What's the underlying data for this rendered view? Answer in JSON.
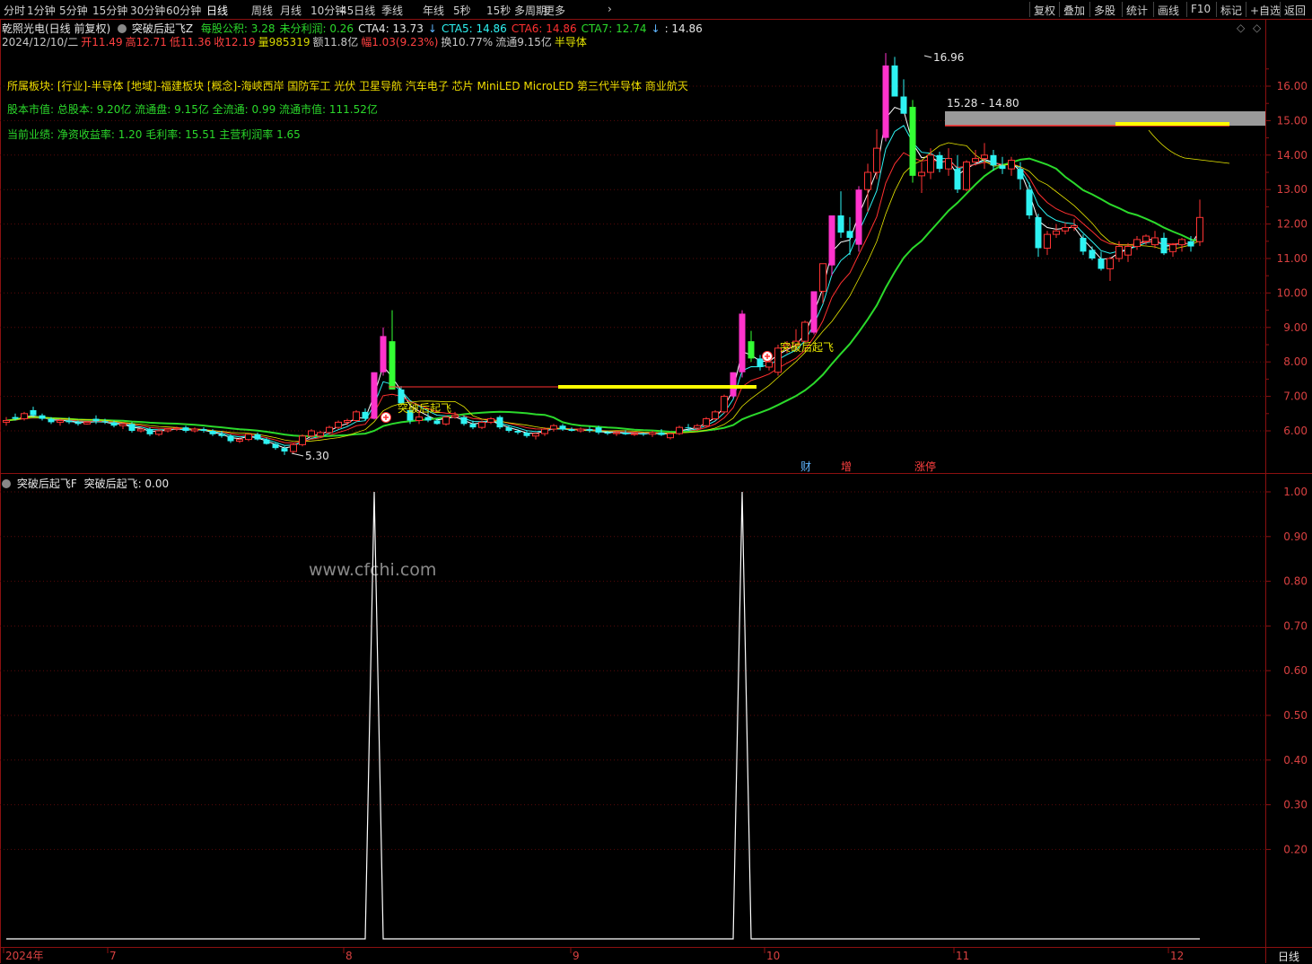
{
  "toolbar": {
    "periods": [
      "分时",
      "1分钟",
      "5分钟",
      "15分钟",
      "30分钟",
      "60分钟",
      "日线",
      "周线",
      "月线",
      "10分钟",
      "45日线",
      "季线",
      "年线",
      "5秒",
      "15秒",
      "多周期",
      "更多"
    ],
    "active": "日线",
    "right_buttons": [
      "复权",
      "叠加",
      "多股",
      "统计",
      "画线",
      "F10",
      "标记",
      "+自选",
      "返回"
    ]
  },
  "header": {
    "stock": "乾照光电(日线 前复权)",
    "indicator": "突破后起飞Z",
    "stats": [
      {
        "text": "每股公积: 3.28",
        "color": "#2bd92b"
      },
      {
        "text": "未分利润: 0.26",
        "color": "#2bd92b"
      },
      {
        "text": "CTA4: 13.73",
        "color": "#e6e6e6"
      },
      {
        "text": "↓",
        "color": "#5fb5ff"
      },
      {
        "text": "CTA5: 14.86",
        "color": "#2ef2f2"
      },
      {
        "text": "CTA6: 14.86",
        "color": "#ff3030"
      },
      {
        "text": "CTA7: 12.74",
        "color": "#2bd92b"
      },
      {
        "text": "↓",
        "color": "#5fb5ff"
      },
      {
        "text": ": 14.86",
        "color": "#e6e6e6"
      }
    ],
    "quote": [
      {
        "text": "2024/12/10/二",
        "color": "#c8c8c8"
      },
      {
        "text": "开11.49",
        "color": "#ff4040"
      },
      {
        "text": "高12.71",
        "color": "#ff4040"
      },
      {
        "text": "低11.36",
        "color": "#ff4040"
      },
      {
        "text": "收12.19",
        "color": "#ff4040"
      },
      {
        "text": "量985319",
        "color": "#d8d800"
      },
      {
        "text": "额11.8亿",
        "color": "#c8c8c8"
      },
      {
        "text": "幅1.03(9.23%)",
        "color": "#ff4040"
      },
      {
        "text": "换10.77%",
        "color": "#c8c8c8"
      },
      {
        "text": "流通9.15亿",
        "color": "#c8c8c8"
      },
      {
        "text": "半导体",
        "color": "#e6e600"
      }
    ]
  },
  "info_panel": {
    "sectors": "所属板块: [行业]-半导体 [地域]-福建板块 [概念]-海峡西岸 国防军工 光伏 卫星导航 汽车电子 芯片 MiniLED MicroLED 第三代半导体 商业航天",
    "capital": "股本市值: 总股本: 9.20亿 流通盘: 9.15亿 全流通: 0.99 流通市值: 111.52亿",
    "performance": "当前业绩: 净资收益率: 1.20 毛利率: 15.51 主营利润率 1.65"
  },
  "price_axis": [
    "16.00",
    "15.00",
    "14.00",
    "13.00",
    "12.00",
    "11.00",
    "10.00",
    "9.00",
    "8.00",
    "7.00",
    "6.00"
  ],
  "annotations": {
    "high": "16.96",
    "low": "5.30",
    "range": "15.28 - 14.80",
    "signal": "突破后起飞",
    "markers": [
      "财",
      "增",
      "涨停"
    ]
  },
  "sub_header": {
    "indicator": "突破后起飞F",
    "value": "突破后起飞: 0.00"
  },
  "sub_axis": [
    "1.00",
    "0.90",
    "0.80",
    "0.70",
    "0.60",
    "0.50",
    "0.40",
    "0.30",
    "0.20"
  ],
  "watermark": "www.cfchi.com",
  "date_axis": [
    "2024年",
    "7",
    "8",
    "9",
    "10",
    "11",
    "12"
  ],
  "period_label": "日线",
  "colors": {
    "up": "#ff3333",
    "down": "#2ef2f2",
    "limit_up": "#ff33cc",
    "limit_down": "#33ff33",
    "border": "#8b1010"
  },
  "chart_data": {
    "type": "candlestick",
    "price_range": [
      5.0,
      17.0
    ],
    "candles": [
      [
        6.25,
        6.4,
        6.15,
        6.3
      ],
      [
        6.4,
        6.5,
        6.3,
        6.35
      ],
      [
        6.35,
        6.55,
        6.3,
        6.5
      ],
      [
        6.6,
        6.7,
        6.4,
        6.45
      ],
      [
        6.45,
        6.5,
        6.3,
        6.35
      ],
      [
        6.35,
        6.4,
        6.2,
        6.25
      ],
      [
        6.25,
        6.35,
        6.15,
        6.3
      ],
      [
        6.3,
        6.4,
        6.2,
        6.25
      ],
      [
        6.25,
        6.3,
        6.15,
        6.2
      ],
      [
        6.2,
        6.28,
        6.18,
        6.25
      ],
      [
        6.35,
        6.45,
        6.2,
        6.28
      ],
      [
        6.28,
        6.35,
        6.2,
        6.25
      ],
      [
        6.25,
        6.3,
        6.1,
        6.15
      ],
      [
        6.15,
        6.25,
        6.05,
        6.2
      ],
      [
        6.2,
        6.25,
        5.95,
        6.0
      ],
      [
        6.0,
        6.1,
        5.95,
        6.05
      ],
      [
        6.05,
        6.1,
        5.85,
        5.9
      ],
      [
        5.9,
        6.05,
        5.85,
        6.0
      ],
      [
        6.0,
        6.05,
        5.95,
        6.05
      ],
      [
        6.05,
        6.12,
        6.0,
        6.08
      ],
      [
        6.1,
        6.15,
        5.95,
        6.0
      ],
      [
        6.0,
        6.1,
        5.95,
        6.05
      ],
      [
        6.05,
        6.1,
        5.95,
        6.0
      ],
      [
        6.0,
        6.05,
        5.85,
        5.9
      ],
      [
        5.9,
        6.0,
        5.8,
        5.85
      ],
      [
        5.85,
        5.9,
        5.65,
        5.7
      ],
      [
        5.7,
        5.8,
        5.65,
        5.75
      ],
      [
        5.75,
        5.92,
        5.7,
        5.9
      ],
      [
        5.9,
        5.95,
        5.72,
        5.75
      ],
      [
        5.75,
        5.8,
        5.6,
        5.62
      ],
      [
        5.62,
        5.65,
        5.45,
        5.5
      ],
      [
        5.5,
        5.55,
        5.3,
        5.4
      ],
      [
        5.4,
        5.65,
        5.35,
        5.6
      ],
      [
        5.6,
        5.9,
        5.55,
        5.85
      ],
      [
        5.85,
        6.05,
        5.8,
        6.0
      ],
      [
        5.85,
        6.0,
        5.8,
        5.95
      ],
      [
        5.95,
        6.15,
        5.9,
        6.1
      ],
      [
        6.1,
        6.3,
        6.05,
        6.25
      ],
      [
        6.25,
        6.35,
        6.15,
        6.3
      ],
      [
        6.3,
        6.6,
        6.25,
        6.55
      ],
      [
        6.55,
        6.65,
        6.3,
        6.35
      ],
      [
        6.35,
        7.7,
        6.33,
        7.7
      ],
      [
        7.7,
        9.0,
        7.6,
        8.75
      ],
      [
        8.6,
        9.5,
        7.2,
        7.2
      ],
      [
        7.2,
        7.3,
        6.8,
        6.8
      ],
      [
        6.6,
        6.7,
        6.2,
        6.3
      ],
      [
        6.3,
        6.6,
        6.2,
        6.4
      ],
      [
        6.4,
        6.55,
        6.25,
        6.3
      ],
      [
        6.3,
        6.35,
        6.18,
        6.2
      ],
      [
        6.2,
        6.45,
        6.15,
        6.4
      ],
      [
        6.4,
        6.55,
        6.35,
        6.45
      ],
      [
        6.4,
        6.45,
        6.15,
        6.2
      ],
      [
        6.2,
        6.3,
        6.05,
        6.1
      ],
      [
        6.1,
        6.3,
        6.05,
        6.25
      ],
      [
        6.25,
        6.4,
        6.2,
        6.35
      ],
      [
        6.4,
        6.45,
        6.05,
        6.1
      ],
      [
        6.1,
        6.15,
        5.95,
        6.0
      ],
      [
        6.0,
        6.05,
        5.9,
        5.95
      ],
      [
        5.95,
        6.0,
        5.8,
        5.85
      ],
      [
        5.85,
        5.95,
        5.75,
        5.92
      ],
      [
        5.92,
        6.1,
        5.85,
        6.05
      ],
      [
        6.05,
        6.2,
        5.98,
        6.15
      ],
      [
        6.15,
        6.2,
        6.0,
        6.05
      ],
      [
        6.05,
        6.1,
        5.98,
        6.0
      ],
      [
        6.0,
        6.1,
        5.95,
        6.05
      ],
      [
        6.05,
        6.12,
        5.95,
        6.0
      ],
      [
        6.1,
        6.15,
        5.9,
        5.95
      ],
      [
        5.95,
        6.0,
        5.88,
        5.92
      ],
      [
        5.92,
        6.0,
        5.85,
        5.95
      ],
      [
        5.95,
        6.02,
        5.88,
        5.9
      ],
      [
        5.9,
        5.95,
        5.85,
        5.92
      ],
      [
        5.92,
        5.95,
        5.85,
        5.9
      ],
      [
        5.9,
        6.0,
        5.82,
        5.95
      ],
      [
        5.95,
        6.05,
        5.85,
        5.88
      ],
      [
        5.8,
        5.95,
        5.75,
        5.92
      ],
      [
        5.92,
        6.15,
        5.88,
        6.1
      ],
      [
        6.1,
        6.2,
        6.0,
        6.08
      ],
      [
        6.08,
        6.2,
        6.0,
        6.15
      ],
      [
        6.15,
        6.4,
        6.1,
        6.35
      ],
      [
        6.35,
        6.6,
        6.3,
        6.55
      ],
      [
        6.55,
        7.05,
        6.5,
        7.0
      ],
      [
        7.0,
        7.7,
        6.95,
        7.7
      ],
      [
        7.7,
        9.5,
        7.55,
        9.4
      ],
      [
        8.6,
        8.9,
        8.0,
        8.1
      ],
      [
        8.1,
        8.2,
        7.75,
        7.85
      ],
      [
        7.85,
        8.05,
        7.75,
        8.0
      ],
      [
        7.7,
        8.5,
        7.6,
        8.4
      ],
      [
        8.4,
        8.6,
        8.25,
        8.5
      ],
      [
        8.5,
        8.95,
        8.35,
        8.6
      ],
      [
        8.6,
        9.2,
        8.55,
        9.15
      ],
      [
        8.85,
        10.05,
        8.8,
        10.05
      ],
      [
        10.05,
        10.8,
        9.7,
        10.85
      ],
      [
        10.8,
        12.25,
        10.5,
        12.25
      ],
      [
        12.25,
        12.95,
        11.6,
        11.75
      ],
      [
        11.8,
        12.2,
        11.1,
        11.6
      ],
      [
        11.4,
        13.1,
        11.2,
        13.0
      ],
      [
        13.0,
        13.75,
        12.35,
        13.5
      ],
      [
        13.5,
        14.75,
        13.3,
        14.2
      ],
      [
        14.5,
        16.96,
        14.4,
        16.6
      ],
      [
        16.6,
        16.85,
        15.8,
        15.7
      ],
      [
        15.7,
        16.2,
        15.3,
        15.2
      ],
      [
        15.4,
        15.6,
        13.2,
        13.4
      ],
      [
        13.4,
        13.8,
        12.9,
        13.5
      ],
      [
        13.5,
        14.2,
        13.3,
        14.0
      ],
      [
        14.0,
        14.1,
        13.5,
        13.6
      ],
      [
        13.6,
        14.2,
        13.4,
        13.9
      ],
      [
        13.6,
        14.0,
        12.9,
        13.0
      ],
      [
        13.0,
        13.85,
        12.95,
        13.8
      ],
      [
        13.8,
        14.15,
        13.7,
        13.9
      ],
      [
        13.9,
        14.35,
        13.6,
        14.0
      ],
      [
        14.0,
        14.15,
        13.55,
        13.7
      ],
      [
        13.7,
        13.95,
        13.45,
        13.6
      ],
      [
        13.6,
        13.95,
        13.4,
        13.85
      ],
      [
        13.6,
        13.8,
        13.0,
        13.3
      ],
      [
        13.0,
        13.2,
        12.15,
        12.25
      ],
      [
        12.2,
        12.3,
        11.05,
        11.3
      ],
      [
        11.3,
        11.8,
        11.1,
        11.7
      ],
      [
        11.7,
        12.0,
        11.6,
        11.8
      ],
      [
        11.8,
        12.05,
        11.7,
        11.9
      ],
      [
        11.9,
        12.15,
        11.8,
        11.95
      ],
      [
        11.6,
        11.7,
        11.1,
        11.2
      ],
      [
        11.25,
        11.35,
        10.95,
        11.0
      ],
      [
        11.0,
        11.2,
        10.65,
        10.7
      ],
      [
        10.7,
        11.05,
        10.35,
        11.0
      ],
      [
        11.0,
        11.5,
        10.9,
        11.35
      ],
      [
        11.1,
        11.45,
        10.9,
        11.35
      ],
      [
        11.35,
        11.65,
        11.25,
        11.55
      ],
      [
        11.5,
        11.7,
        11.4,
        11.65
      ],
      [
        11.4,
        11.8,
        11.3,
        11.6
      ],
      [
        11.6,
        11.75,
        11.1,
        11.15
      ],
      [
        11.2,
        11.45,
        11.05,
        11.4
      ],
      [
        11.4,
        11.6,
        11.2,
        11.55
      ],
      [
        11.5,
        11.65,
        11.2,
        11.35
      ],
      [
        11.49,
        12.71,
        11.36,
        12.19
      ]
    ],
    "series": [
      {
        "name": "CTA4",
        "color": "#e6e6e6",
        "last": 13.73
      },
      {
        "name": "CTA5",
        "color": "#2ef2f2",
        "last": 14.86
      },
      {
        "name": "CTA6",
        "color": "#ff3030",
        "last": 14.86
      },
      {
        "name": "CTA7",
        "color": "#2bd92b",
        "last": 12.74
      }
    ],
    "signal_values": {
      "indices": [
        41,
        82
      ],
      "value": 1.0
    }
  }
}
